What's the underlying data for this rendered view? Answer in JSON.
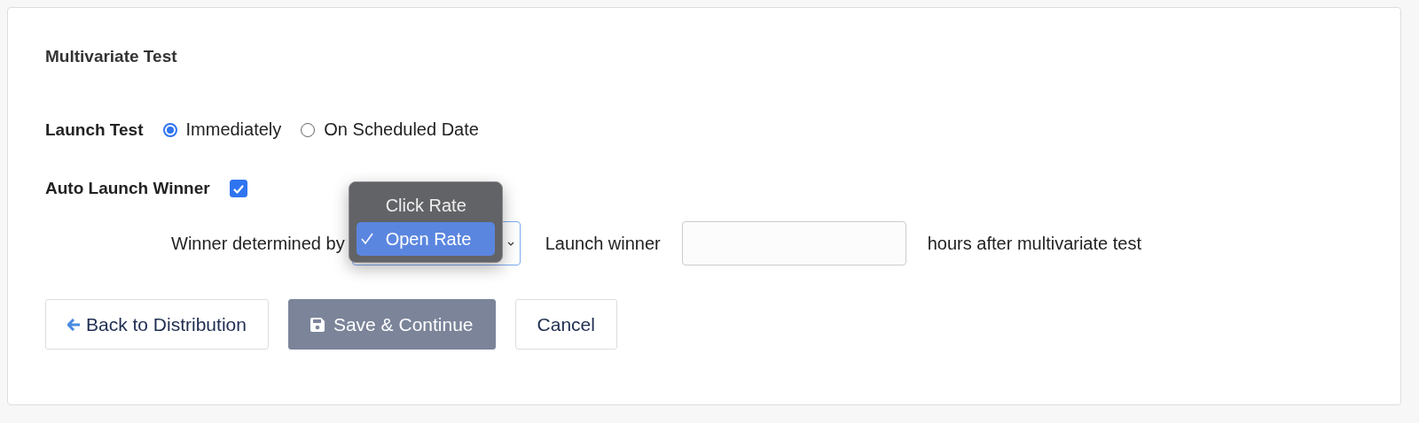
{
  "panel": {
    "title": "Multivariate Test"
  },
  "launch_test": {
    "label": "Launch Test",
    "options": [
      {
        "label": "Immediately",
        "selected": true
      },
      {
        "label": "On Scheduled Date",
        "selected": false
      }
    ]
  },
  "auto_launch_winner": {
    "label": "Auto Launch Winner",
    "checked": true
  },
  "winner_row": {
    "label": "Winner determined by",
    "dropdown": {
      "expanded": true,
      "options": [
        {
          "label": "Click Rate",
          "selected": false
        },
        {
          "label": "Open Rate",
          "selected": true
        }
      ]
    },
    "launch_label": "Launch winner",
    "hours_suffix": "hours after multivariate test"
  },
  "buttons": [
    {
      "label": "Back to Distribution",
      "kind": "back"
    },
    {
      "label": "Save & Continue",
      "kind": "save"
    },
    {
      "label": "Cancel",
      "kind": "plain"
    }
  ]
}
